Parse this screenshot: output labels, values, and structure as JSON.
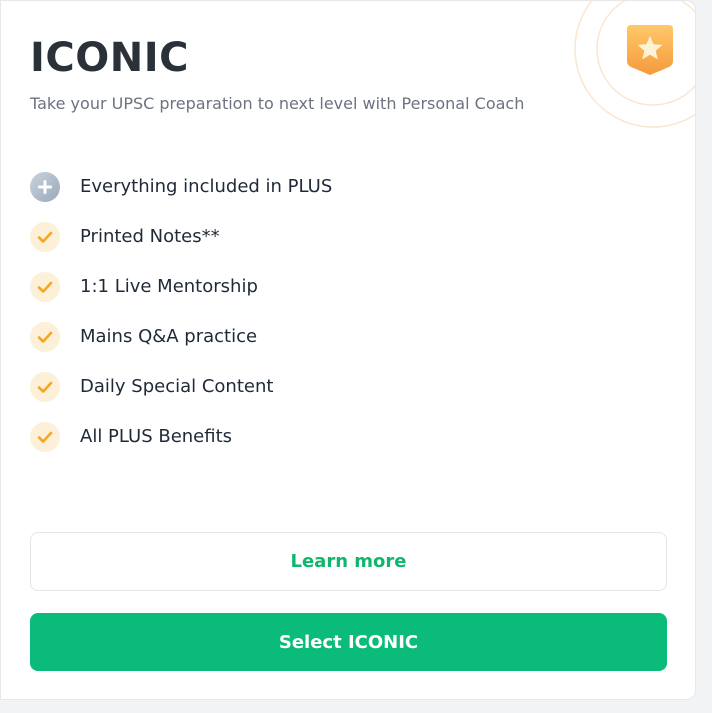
{
  "plan": {
    "title": "ICONIC",
    "subtitle": "Take your UPSC preparation to next level with Personal Coach",
    "badge_icon": "star-badge-icon"
  },
  "features": [
    {
      "label": "Everything included in PLUS",
      "icon": "plus-icon"
    },
    {
      "label": "Printed Notes**",
      "icon": "check-icon"
    },
    {
      "label": "1:1 Live Mentorship",
      "icon": "check-icon"
    },
    {
      "label": "Mains Q&A practice",
      "icon": "check-icon"
    },
    {
      "label": "Daily Special Content",
      "icon": "check-icon"
    },
    {
      "label": "All PLUS Benefits",
      "icon": "check-icon"
    }
  ],
  "actions": {
    "learn_more_label": "Learn more",
    "select_label": "Select ICONIC"
  },
  "colors": {
    "primary_green": "#0abb7a",
    "check_orange": "#f5a623",
    "check_bg": "#fdf0d8",
    "badge_orange": "#f7a743"
  }
}
